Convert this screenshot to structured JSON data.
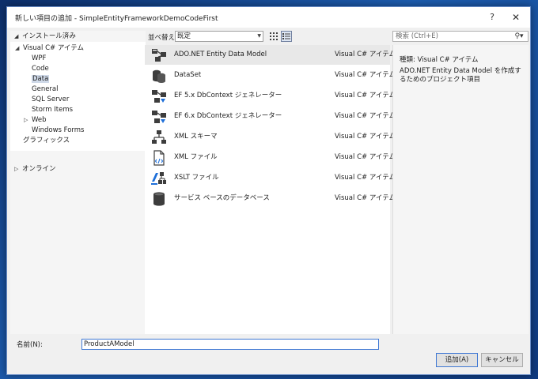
{
  "window": {
    "title": "新しい項目の追加 - SimpleEntityFrameworkDemoCodeFirst",
    "help_label": "?",
    "close_label": "✕"
  },
  "tree": {
    "installed_label": "インストール済み",
    "items": [
      {
        "label": "Visual C# アイテム",
        "expander": "◢",
        "level": 1
      },
      {
        "label": "WPF",
        "level": 2
      },
      {
        "label": "Code",
        "level": 2
      },
      {
        "label": "Data",
        "level": 2,
        "selected": true
      },
      {
        "label": "General",
        "level": 2
      },
      {
        "label": "SQL Server",
        "level": 2
      },
      {
        "label": "Storm Items",
        "level": 2
      },
      {
        "label": "Web",
        "expander": "▷",
        "level": 2
      },
      {
        "label": "Windows Forms",
        "level": 2
      },
      {
        "label": "グラフィックス",
        "level": 1
      }
    ],
    "online_label": "オンライン"
  },
  "toolbar": {
    "sort_label": "並べ替え:",
    "sort_value": "既定",
    "search_placeholder": "検索 (Ctrl+E)"
  },
  "templates": [
    {
      "name": "ADO.NET Entity Data Model",
      "type": "Visual C# アイテム",
      "icon": "entity-model-icon",
      "selected": true
    },
    {
      "name": "DataSet",
      "type": "Visual C# アイテム",
      "icon": "dataset-icon"
    },
    {
      "name": "EF 5.x DbContext ジェネレーター",
      "type": "Visual C# アイテム",
      "icon": "ef-generator-icon"
    },
    {
      "name": "EF 6.x DbContext ジェネレーター",
      "type": "Visual C# アイテム",
      "icon": "ef-generator-icon"
    },
    {
      "name": "XML スキーマ",
      "type": "Visual C# アイテム",
      "icon": "xml-schema-icon"
    },
    {
      "name": "XML ファイル",
      "type": "Visual C# アイテム",
      "icon": "xml-file-icon"
    },
    {
      "name": "XSLT ファイル",
      "type": "Visual C# アイテム",
      "icon": "xslt-file-icon"
    },
    {
      "name": "サービス ベースのデータベース",
      "type": "Visual C# アイテム",
      "icon": "database-icon"
    }
  ],
  "details": {
    "type_line": "種類:  Visual C# アイテム",
    "description": "ADO.NET Entity Data Model を作成するためのプロジェクト項目"
  },
  "name_field": {
    "label": "名前(N):",
    "value": "ProductAModel"
  },
  "buttons": {
    "add": "追加(A)",
    "cancel": "キャンセル"
  }
}
